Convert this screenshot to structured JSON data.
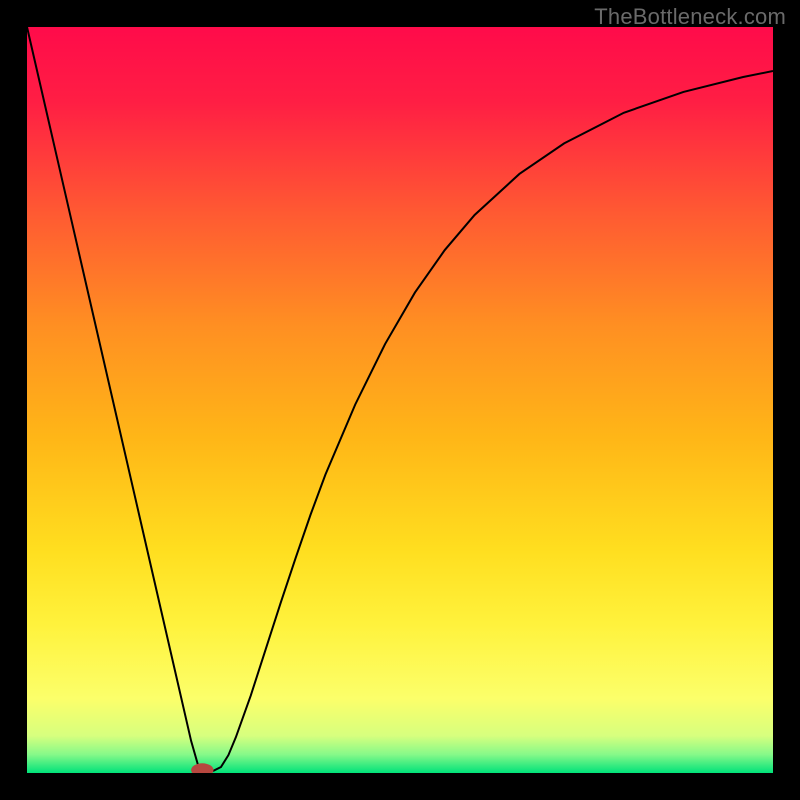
{
  "watermark": "TheBottleneck.com",
  "chart_data": {
    "type": "line",
    "title": "",
    "xlabel": "",
    "ylabel": "",
    "xlim": [
      0,
      100
    ],
    "ylim": [
      0,
      100
    ],
    "grid": false,
    "legend": false,
    "background": {
      "type": "vertical-gradient",
      "stops": [
        {
          "pos": 0.0,
          "color": "#ff0b4a"
        },
        {
          "pos": 0.1,
          "color": "#ff1e44"
        },
        {
          "pos": 0.25,
          "color": "#ff5a32"
        },
        {
          "pos": 0.4,
          "color": "#ff8f22"
        },
        {
          "pos": 0.55,
          "color": "#ffb617"
        },
        {
          "pos": 0.7,
          "color": "#ffde1f"
        },
        {
          "pos": 0.8,
          "color": "#fff23c"
        },
        {
          "pos": 0.9,
          "color": "#fcff6a"
        },
        {
          "pos": 0.95,
          "color": "#d7ff7e"
        },
        {
          "pos": 0.975,
          "color": "#87f989"
        },
        {
          "pos": 1.0,
          "color": "#00e27a"
        }
      ]
    },
    "series": [
      {
        "name": "bottleneck-curve",
        "color": "#000000",
        "width": 2,
        "x": [
          0,
          2,
          4,
          6,
          8,
          10,
          12,
          14,
          16,
          18,
          20,
          22,
          23,
          24,
          25,
          26,
          27,
          28,
          30,
          32,
          34,
          36,
          38,
          40,
          44,
          48,
          52,
          56,
          60,
          66,
          72,
          80,
          88,
          96,
          100
        ],
        "y": [
          100,
          91.3,
          82.6,
          73.9,
          65.2,
          56.5,
          47.8,
          39.1,
          30.4,
          21.7,
          13.0,
          4.3,
          0.8,
          0.3,
          0.3,
          0.8,
          2.4,
          4.8,
          10.4,
          16.6,
          22.8,
          28.8,
          34.6,
          40.0,
          49.4,
          57.5,
          64.4,
          70.1,
          74.8,
          80.3,
          84.4,
          88.5,
          91.3,
          93.3,
          94.1
        ]
      }
    ],
    "marker": {
      "name": "optimal-point",
      "x": 23.5,
      "y": 0.4,
      "rx": 1.5,
      "ry": 0.9,
      "color": "#b7473f"
    }
  }
}
